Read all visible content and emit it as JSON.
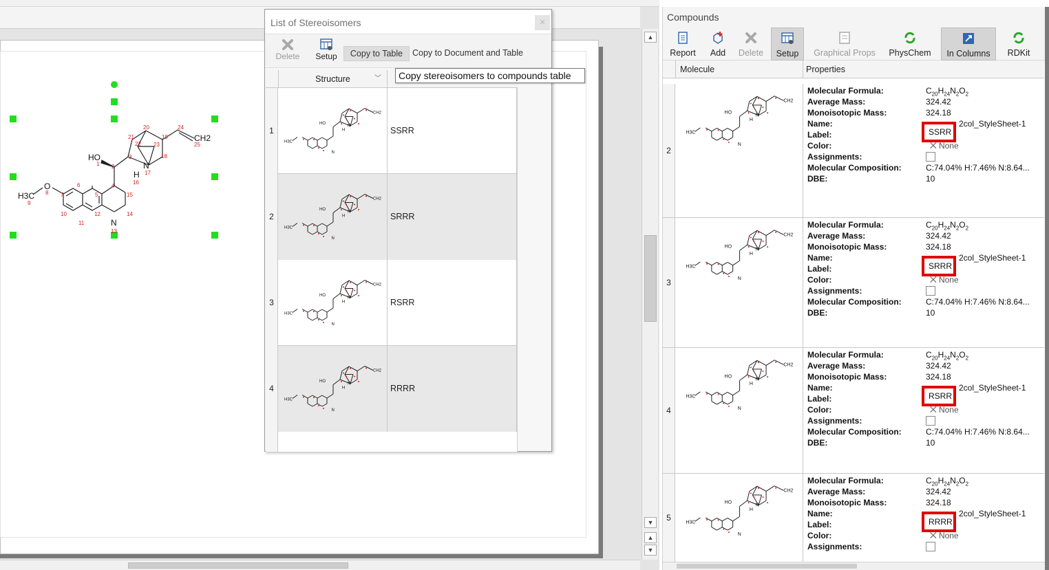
{
  "dialog": {
    "title": "List of Stereoisomers",
    "toolbar": {
      "delete_label": "Delete",
      "setup_label": "Setup",
      "copy_to_table_label": "Copy to Table",
      "copy_to_doc_label": "Copy to Document and Table"
    },
    "tooltip": "Copy stereoisomers to compounds table",
    "column_structure": "Structure",
    "rows": [
      {
        "num": "1",
        "label": "SSRR"
      },
      {
        "num": "2",
        "label": "SRRR"
      },
      {
        "num": "3",
        "label": "RSRR"
      },
      {
        "num": "4",
        "label": "RRRR"
      }
    ]
  },
  "molecule": {
    "labels": {
      "ho": "HO",
      "h3c": "H3C",
      "o": "O",
      "n": "N",
      "h": "H",
      "ch2": "CH2"
    },
    "atom_numbers": [
      "1",
      "2",
      "3",
      "4",
      "5",
      "6",
      "7",
      "8",
      "9",
      "10",
      "11",
      "12",
      "13",
      "14",
      "15",
      "16",
      "17",
      "18",
      "19",
      "20",
      "21",
      "22",
      "23",
      "24",
      "25"
    ]
  },
  "compounds": {
    "title": "Compounds",
    "toolbar": [
      {
        "label": "Report",
        "icon": "report-icon"
      },
      {
        "label": "Add",
        "icon": "add-icon"
      },
      {
        "label": "Delete",
        "icon": "delete-icon"
      },
      {
        "label": "Setup",
        "icon": "setup-icon"
      },
      {
        "label": "Graphical Props",
        "icon": "graphical-props-icon"
      },
      {
        "label": "PhysChem",
        "icon": "physchem-icon"
      },
      {
        "label": "In Columns",
        "icon": "in-columns-icon"
      },
      {
        "label": "RDKit",
        "icon": "rdkit-icon"
      }
    ],
    "columns": {
      "molecule": "Molecule",
      "properties": "Properties"
    },
    "prop_labels": {
      "formula": "Molecular Formula:",
      "avg_mass": "Average Mass:",
      "mono_mass": "Monoisotopic Mass:",
      "name": "Name:",
      "label": "Label:",
      "color": "Color:",
      "assignments": "Assignments:",
      "composition": "Molecular Composition:",
      "dbe": "DBE:"
    },
    "rows": [
      {
        "num": "2",
        "formula_c": "C",
        "formula_c_n": "20",
        "formula_h": "H",
        "formula_h_n": "24",
        "formula_n": "N",
        "formula_n_n": "2",
        "formula_o": "O",
        "formula_o_n": "2",
        "avg_mass": "324.42",
        "mono_mass": "324.18",
        "name": "2col_StyleSheet-1",
        "label": "SSRR",
        "color": "None",
        "composition": "C:74.04% H:7.46% N:8.64...",
        "dbe": "10"
      },
      {
        "num": "3",
        "formula_c": "C",
        "formula_c_n": "20",
        "formula_h": "H",
        "formula_h_n": "24",
        "formula_n": "N",
        "formula_n_n": "2",
        "formula_o": "O",
        "formula_o_n": "2",
        "avg_mass": "324.42",
        "mono_mass": "324.18",
        "name": "2col_StyleSheet-1",
        "label": "SRRR",
        "color": "None",
        "composition": "C:74.04% H:7.46% N:8.64...",
        "dbe": "10"
      },
      {
        "num": "4",
        "formula_c": "C",
        "formula_c_n": "20",
        "formula_h": "H",
        "formula_h_n": "24",
        "formula_n": "N",
        "formula_n_n": "2",
        "formula_o": "O",
        "formula_o_n": "2",
        "avg_mass": "324.42",
        "mono_mass": "324.18",
        "name": "2col_StyleSheet-1",
        "label": "RSRR",
        "color": "None",
        "composition": "C:74.04% H:7.46% N:8.64...",
        "dbe": "10"
      },
      {
        "num": "5",
        "formula_c": "C",
        "formula_c_n": "20",
        "formula_h": "H",
        "formula_h_n": "24",
        "formula_n": "N",
        "formula_n_n": "2",
        "formula_o": "O",
        "formula_o_n": "2",
        "avg_mass": "324.42",
        "mono_mass": "324.18",
        "name": "2col_StyleSheet-1",
        "label": "RRRR",
        "color": "None"
      }
    ]
  },
  "colors": {
    "highlight": "#e00000",
    "selection_handle": "#22dd22",
    "atom_number": "#d42020"
  }
}
